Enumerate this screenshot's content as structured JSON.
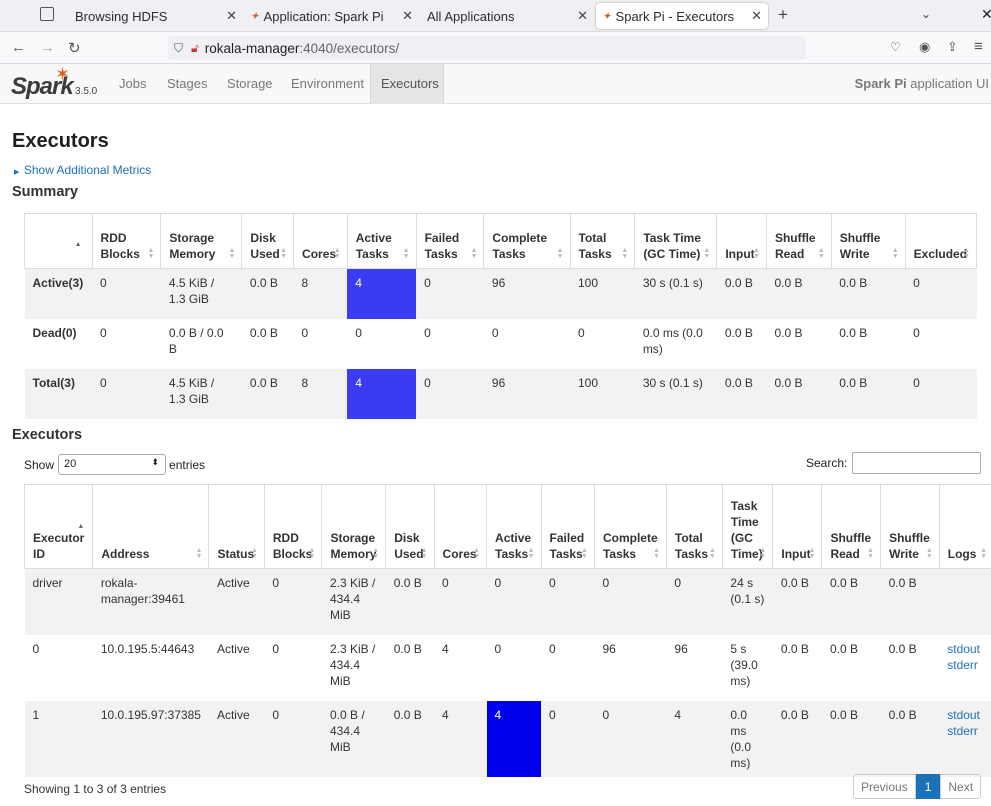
{
  "browser": {
    "tabs": [
      {
        "label": "Browsing HDFS"
      },
      {
        "label": "Application: Spark Pi"
      },
      {
        "label": "All Applications"
      },
      {
        "label": "Spark Pi - Executors"
      }
    ],
    "url_host": "rokala-manager",
    "url_rest": ":4040/executors/"
  },
  "spark_nav": {
    "version": "3.5.0",
    "items": [
      "Jobs",
      "Stages",
      "Storage",
      "Environment",
      "Executors"
    ],
    "app_name": "Spark Pi",
    "app_suffix": " application UI"
  },
  "page": {
    "title": "Executors",
    "show_metrics": "Show Additional Metrics",
    "summary_title": "Summary",
    "executors_title": "Executors"
  },
  "summary": {
    "headers": [
      "",
      "RDD Blocks",
      "Storage Memory",
      "Disk Used",
      "Cores",
      "Active Tasks",
      "Failed Tasks",
      "Complete Tasks",
      "Total Tasks",
      "Task Time (GC Time)",
      "Input",
      "Shuffle Read",
      "Shuffle Write",
      "Excluded"
    ],
    "rows": [
      [
        "Active(3)",
        "0",
        "4.5 KiB / 1.3 GiB",
        "0.0 B",
        "8",
        "4",
        "0",
        "96",
        "100",
        "30 s (0.1 s)",
        "0.0 B",
        "0.0 B",
        "0.0 B",
        "0"
      ],
      [
        "Dead(0)",
        "0",
        "0.0 B / 0.0 B",
        "0.0 B",
        "0",
        "0",
        "0",
        "0",
        "0",
        "0.0 ms (0.0 ms)",
        "0.0 B",
        "0.0 B",
        "0.0 B",
        "0"
      ],
      [
        "Total(3)",
        "0",
        "4.5 KiB / 1.3 GiB",
        "0.0 B",
        "8",
        "4",
        "0",
        "96",
        "100",
        "30 s (0.1 s)",
        "0.0 B",
        "0.0 B",
        "0.0 B",
        "0"
      ]
    ]
  },
  "controls": {
    "show": "Show",
    "page_size": "20",
    "entries": "entries",
    "search": "Search:"
  },
  "executors": {
    "headers": [
      "Executor ID",
      "Address",
      "Status",
      "RDD Blocks",
      "Storage Memory",
      "Disk Used",
      "Cores",
      "Active Tasks",
      "Failed Tasks",
      "Complete Tasks",
      "Total Tasks",
      "Task Time (GC Time)",
      "Input",
      "Shuffle Read",
      "Shuffle Write",
      "Logs"
    ],
    "rows": [
      [
        "driver",
        "rokala-manager:39461",
        "Active",
        "0",
        "2.3 KiB / 434.4 MiB",
        "0.0 B",
        "0",
        "0",
        "0",
        "0",
        "0",
        "24 s (0.1 s)",
        "0.0 B",
        "0.0 B",
        "0.0 B",
        ""
      ],
      [
        "0",
        "10.0.195.5:44643",
        "Active",
        "0",
        "2.3 KiB / 434.4 MiB",
        "0.0 B",
        "4",
        "0",
        "0",
        "96",
        "96",
        "5 s (39.0 ms)",
        "0.0 B",
        "0.0 B",
        "0.0 B",
        "stdout stderr"
      ],
      [
        "1",
        "10.0.195.97:37385",
        "Active",
        "0",
        "0.0 B / 434.4 MiB",
        "0.0 B",
        "4",
        "4",
        "0",
        "0",
        "4",
        "0.0 ms (0.0 ms)",
        "0.0 B",
        "0.0 B",
        "0.0 B",
        "stdout stderr"
      ]
    ]
  },
  "footer": {
    "info": "Showing 1 to 3 of 3 entries",
    "prev": "Previous",
    "page": "1",
    "next": "Next"
  },
  "colors": {
    "active_tasks_summary": "#3b3bf2",
    "active_tasks_exec": "#0000f0",
    "link": "#1a73b8",
    "spark_orange": "#e25a1c"
  }
}
